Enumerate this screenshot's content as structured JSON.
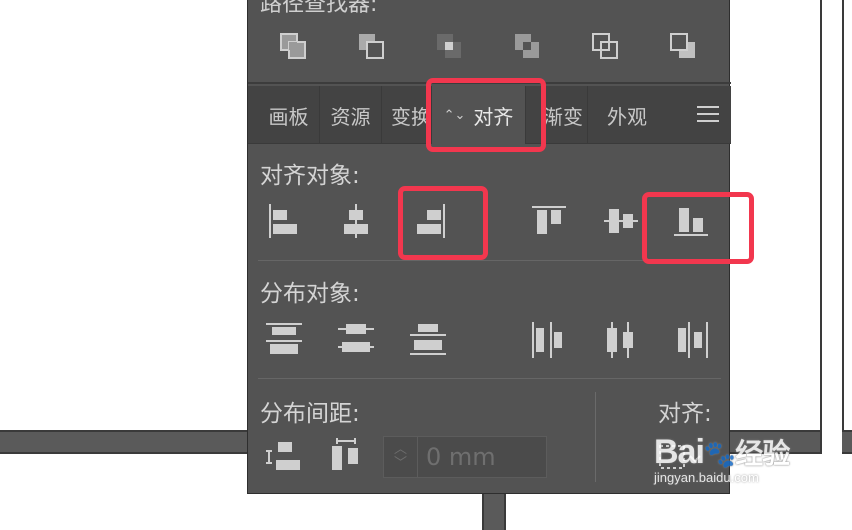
{
  "pathfinder": {
    "title": "路径查找器:",
    "icons": [
      "unite-icon",
      "minus-front-icon",
      "intersect-icon",
      "exclude-icon",
      "divide-icon",
      "trim-icon"
    ]
  },
  "tabs": [
    {
      "label": "画板",
      "active": false
    },
    {
      "label": "资源",
      "active": false
    },
    {
      "label": "变换",
      "active": false
    },
    {
      "label": "对齐",
      "active": true,
      "arrows": "⌃⌄"
    },
    {
      "label": "渐变",
      "active": false
    },
    {
      "label": "外观",
      "active": false
    }
  ],
  "align_objects": {
    "label": "对齐对象:",
    "icons": [
      "align-left-icon",
      "align-horizontal-center-icon",
      "align-right-icon",
      "align-top-icon",
      "align-vertical-center-icon",
      "align-bottom-icon"
    ]
  },
  "distribute_objects": {
    "label": "分布对象:",
    "icons": [
      "distribute-top-icon",
      "distribute-vertical-center-icon",
      "distribute-bottom-icon",
      "distribute-left-icon",
      "distribute-horizontal-center-icon",
      "distribute-right-icon"
    ]
  },
  "distribute_spacing": {
    "label": "分布间距:",
    "value": "0 mm"
  },
  "align_to": {
    "label": "对齐:"
  },
  "watermark": {
    "logo": "Bai",
    "logo_suffix": "经验",
    "url": "jingyan.baidu.com"
  },
  "colors": {
    "panel": "#535353",
    "tabbar": "#434343",
    "highlight": "#f2374e"
  }
}
